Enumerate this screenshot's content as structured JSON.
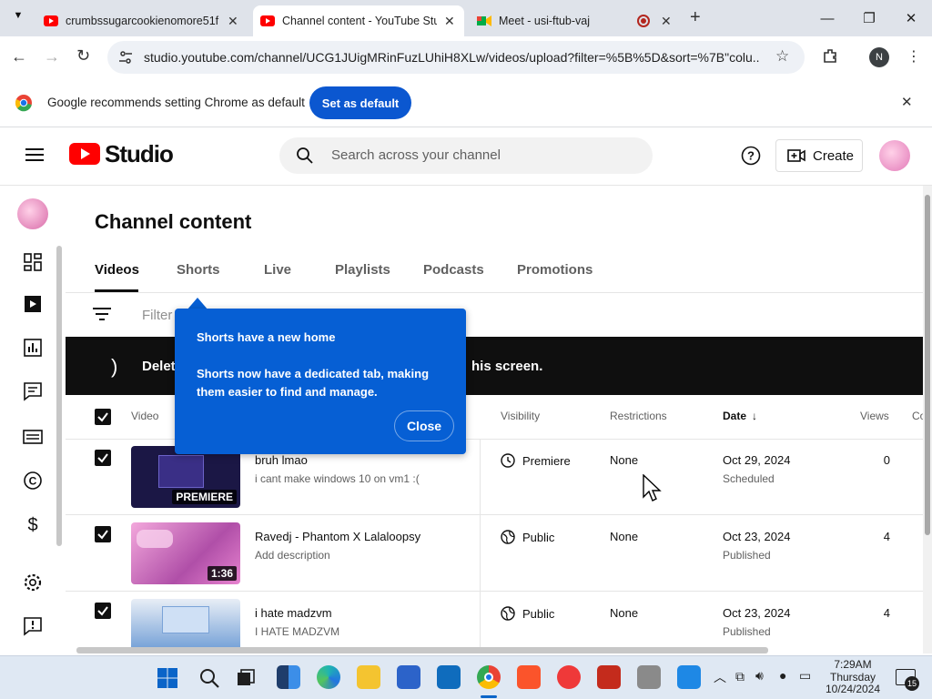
{
  "browser": {
    "tabs": [
      {
        "title": "crumbssugarcookienomore51f",
        "active": false
      },
      {
        "title": "Channel content - YouTube Stu",
        "active": true
      },
      {
        "title": "Meet - usi-ftub-vaj",
        "active": false
      }
    ],
    "url": "studio.youtube.com/channel/UCG1JUigMRinFuzLUhiH8XLw/videos/upload?filter=%5B%5D&sort=%7B\"colu...",
    "profile_initial": "N"
  },
  "infobar": {
    "message": "Google recommends setting Chrome as default",
    "button": "Set as default"
  },
  "studio": {
    "logo_text": "Studio",
    "search_placeholder": "Search across your channel",
    "create_label": "Create"
  },
  "page": {
    "title": "Channel content",
    "tabs": [
      "Videos",
      "Shorts",
      "Live",
      "Playlists",
      "Podcasts",
      "Promotions"
    ],
    "filter_label": "Filter",
    "banner_prefix": "Deleti",
    "banner_suffix": "his screen."
  },
  "table": {
    "headers": {
      "video": "Video",
      "visibility": "Visibility",
      "restrictions": "Restrictions",
      "date": "Date",
      "views": "Views",
      "comments": "Co"
    },
    "rows": [
      {
        "title": "bruh lmao",
        "description": "i cant make windows 10 on vm1 :(",
        "badge": "PREMIERE",
        "visibility": "Premiere",
        "restrictions": "None",
        "date": "Oct 29, 2024",
        "status": "Scheduled",
        "views": "0"
      },
      {
        "title": "Ravedj - Phantom X Lalaloopsy",
        "description": "Add description",
        "badge": "1:36",
        "visibility": "Public",
        "restrictions": "None",
        "date": "Oct 23, 2024",
        "status": "Published",
        "views": "4"
      },
      {
        "title": "i hate madzvm",
        "description": "I HATE MADZVM",
        "badge": "",
        "visibility": "Public",
        "restrictions": "None",
        "date": "Oct 23, 2024",
        "status": "Published",
        "views": "4"
      }
    ]
  },
  "tooltip": {
    "title": "Shorts have a new home",
    "body": "Shorts now have a dedicated tab, making them easier to find and manage.",
    "close": "Close"
  },
  "taskbar": {
    "time": "7:29AM",
    "day": "Thursday",
    "date": "10/24/2024",
    "notifications": "15"
  },
  "colors": {
    "youtube_red": "#ff0000",
    "accent_blue": "#065fd4",
    "chrome_blue": "#0b57d0"
  }
}
